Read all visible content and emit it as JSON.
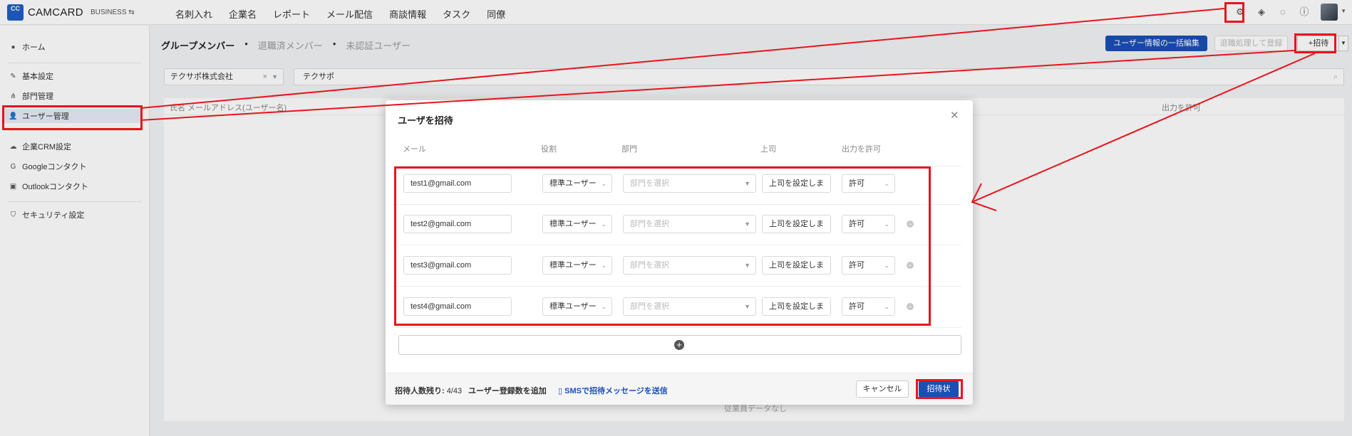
{
  "app": {
    "logo_mark": "CC",
    "name": "CAMCARD",
    "edition": "BUSINESS ⇆"
  },
  "nav": [
    "名刺入れ",
    "企業名",
    "レポート",
    "メール配信",
    "商談情報",
    "タスク",
    "同僚"
  ],
  "top_icons": [
    "settings-icon",
    "layers-icon",
    "chat-icon",
    "help-icon"
  ],
  "sidebar": {
    "home": "ホーム",
    "basic_settings": "基本設定",
    "department": "部門管理",
    "user_management": "ユーザー管理",
    "crm_settings": "企業CRM設定",
    "google_contacts": "Googleコンタクト",
    "outlook_contacts": "Outlookコンタクト",
    "security": "セキュリティ設定"
  },
  "tabs": {
    "group_members": "グループメンバー",
    "retired": "退職済メンバー",
    "unverified": "未認証ユーザー",
    "separator": "•"
  },
  "actions": {
    "bulk_edit": "ユーザー情報の一括編集",
    "ghost": "退職処理して登録",
    "invite": "+招待"
  },
  "filters": {
    "company": "テクサポ株式会社",
    "search": "テクサポ"
  },
  "table": {
    "col_name": "氏名 メールアドレス(ユーザー名)",
    "col_output": "出力を許可",
    "empty": "従業員データなし"
  },
  "modal": {
    "title": "ユーザを招待",
    "headers": {
      "email": "メール",
      "role": "役割",
      "department": "部門",
      "supervisor": "上司",
      "output": "出力を許可"
    },
    "rows": [
      {
        "email": "test1@gmail.com",
        "role": "標準ユーザー",
        "department": "部門を選択",
        "supervisor": "上司を設定しま",
        "output": "許可"
      },
      {
        "email": "test2@gmail.com",
        "role": "標準ユーザー",
        "department": "部門を選択",
        "supervisor": "上司を設定しま",
        "output": "許可"
      },
      {
        "email": "test3@gmail.com",
        "role": "標準ユーザー",
        "department": "部門を選択",
        "supervisor": "上司を設定しま",
        "output": "許可"
      },
      {
        "email": "test4@gmail.com",
        "role": "標準ユーザー",
        "department": "部門を選択",
        "supervisor": "上司を設定しま",
        "output": "許可"
      }
    ],
    "footer": {
      "remaining_label": "招待人数残り:",
      "remaining_value": "4/43",
      "add_license": "ユーザー登録数を追加",
      "sms": "SMSで招待メッセージを送信",
      "cancel": "キャンセル",
      "send": "招待状"
    }
  },
  "colors": {
    "accent": "#1b4fb6",
    "annotation": "#e8141c"
  }
}
